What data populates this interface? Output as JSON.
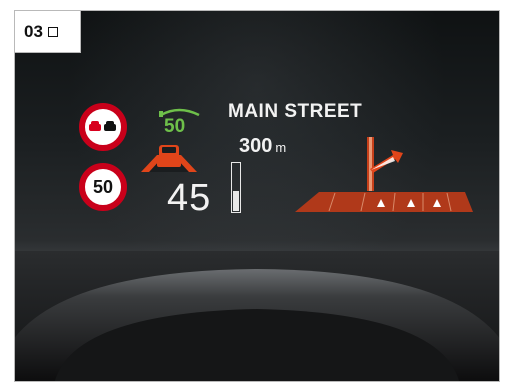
{
  "figure_tag": "03",
  "hud": {
    "street_name": "MAIN STREET",
    "distance_value": "300",
    "distance_unit": "m",
    "current_speed": "45",
    "set_speed": "50",
    "speed_limit_sign": "50",
    "speed_bar_level": 0.4
  },
  "colors": {
    "sign_red": "#c9001a",
    "acc_green": "#6ec04a",
    "nav_orange": "#e0451a",
    "text_white": "#f2f2f2"
  },
  "icons": [
    "no-overtaking-sign-icon",
    "speed-limit-sign-icon",
    "acc-vehicle-icon",
    "turn-arrow-icon",
    "lane-guidance-icon"
  ]
}
